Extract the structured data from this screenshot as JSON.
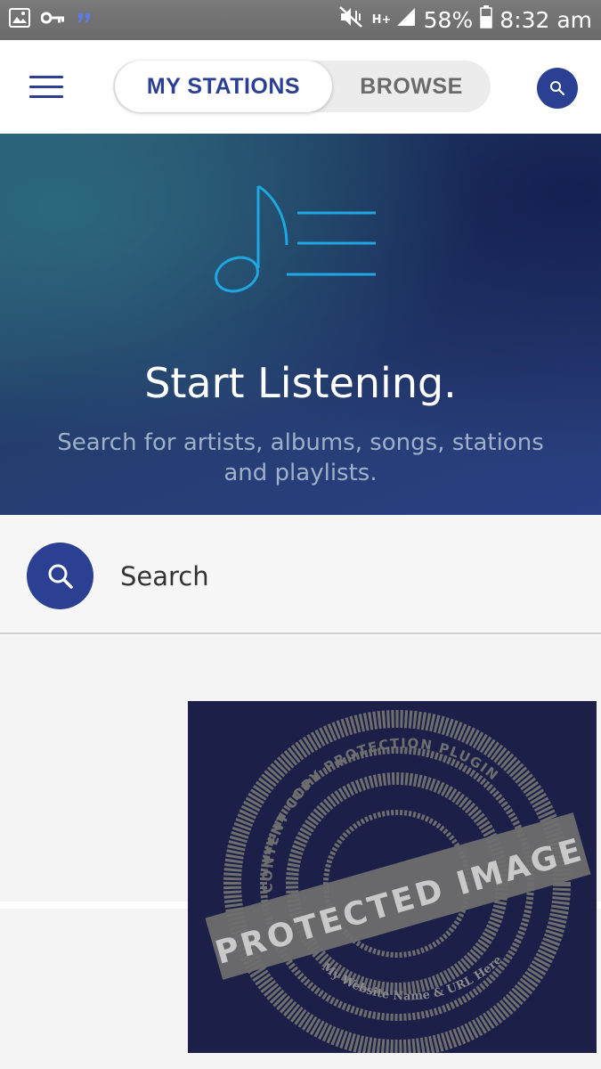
{
  "status_bar": {
    "battery": "58%",
    "time": "8:32 am",
    "network": "H+"
  },
  "header": {
    "tabs": [
      {
        "label": "MY STATIONS",
        "active": true
      },
      {
        "label": "BROWSE",
        "active": false
      }
    ]
  },
  "hero": {
    "title": "Start Listening.",
    "subtitle": "Search for artists, albums, songs, stations and playlists."
  },
  "search": {
    "label": "Search"
  },
  "watermark": {
    "main_text": "PROTECTED IMAGE",
    "ring_text": "CONTENT COPY PROTECTION PLUGIN",
    "bottom_text": "My Website Name & URL Here"
  },
  "colors": {
    "brand": "#2b3f93",
    "hero_icon": "#1ea7e1",
    "watermark_bg": "#1c2049",
    "watermark_ink": "#6e6e6e"
  }
}
